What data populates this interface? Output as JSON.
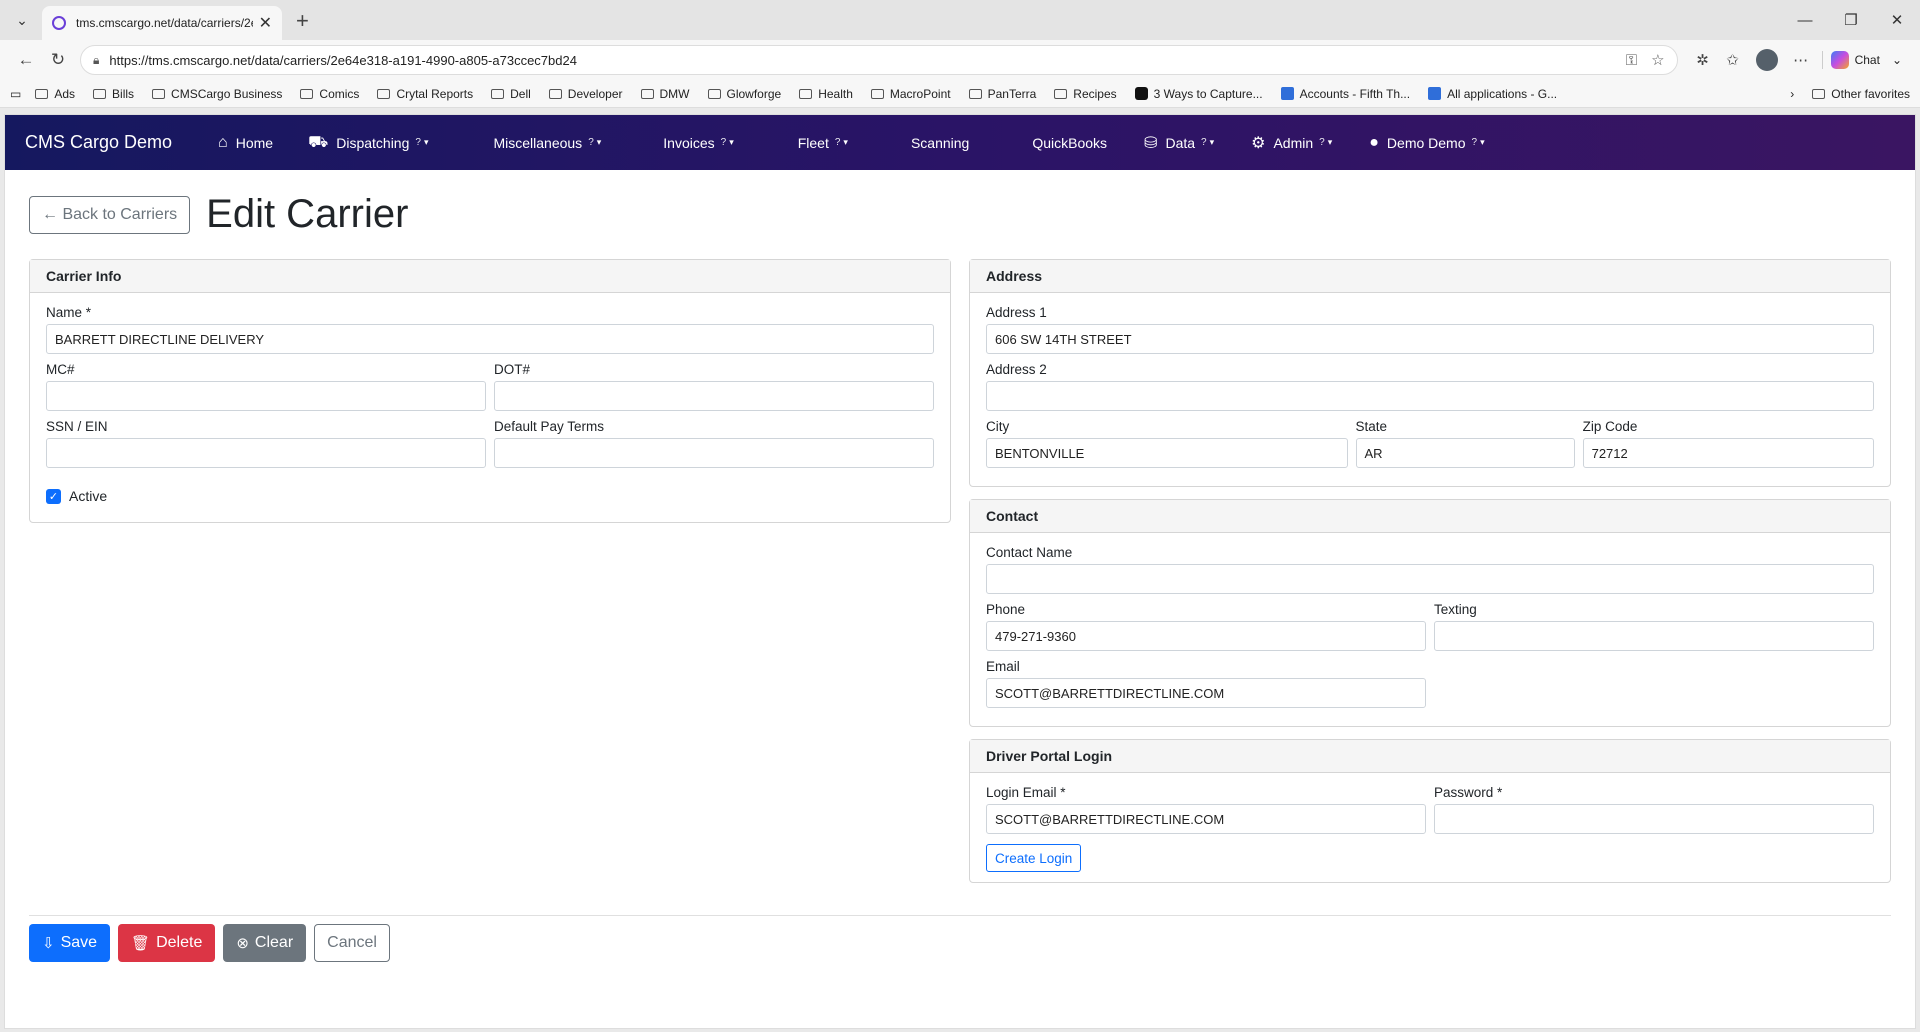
{
  "browser": {
    "tab_title": "tms.cmscargo.net/data/carriers/2e",
    "url": "https://tms.cmscargo.net/data/carriers/2e64e318-a191-4990-a805-a73ccec7bd24",
    "chat_label": "Chat",
    "bookmarks": [
      "Ads",
      "Bills",
      "CMSCargo Business",
      "Comics",
      "Crytal Reports",
      "Dell",
      "Developer",
      "DMW",
      "Glowforge",
      "Health",
      "MacroPoint",
      "PanTerra",
      "Recipes",
      "3 Ways to Capture...",
      "Accounts - Fifth Th...",
      "All applications - G..."
    ],
    "other_favorites": "Other favorites"
  },
  "nav": {
    "brand": "CMS Cargo Demo",
    "items": {
      "home": "Home",
      "dispatching": "Dispatching",
      "miscellaneous": "Miscellaneous",
      "invoices": "Invoices",
      "fleet": "Fleet",
      "scanning": "Scanning",
      "quickbooks": "QuickBooks",
      "data": "Data",
      "admin": "Admin",
      "user": "Demo Demo"
    },
    "help_mark": "?"
  },
  "page": {
    "back_label": "← Back to Carriers",
    "title": "Edit Carrier"
  },
  "carrier_info": {
    "header": "Carrier Info",
    "name_label": "Name *",
    "name_value": "BARRETT DIRECTLINE DELIVERY",
    "mc_label": "MC#",
    "mc_value": "",
    "dot_label": "DOT#",
    "dot_value": "",
    "ssn_label": "SSN / EIN",
    "ssn_value": "",
    "pay_terms_label": "Default Pay Terms",
    "pay_terms_value": "",
    "active_label": "Active",
    "active_checked": true
  },
  "address": {
    "header": "Address",
    "address1_label": "Address 1",
    "address1_value": "606 SW 14TH STREET",
    "address2_label": "Address 2",
    "address2_value": "",
    "city_label": "City",
    "city_value": "BENTONVILLE",
    "state_label": "State",
    "state_value": "AR",
    "zip_label": "Zip Code",
    "zip_value": "72712"
  },
  "contact": {
    "header": "Contact",
    "name_label": "Contact Name",
    "name_value": "",
    "phone_label": "Phone",
    "phone_value": "479-271-9360",
    "texting_label": "Texting",
    "texting_value": "",
    "email_label": "Email",
    "email_value": "SCOTT@BARRETTDIRECTLINE.COM"
  },
  "driver_portal": {
    "header": "Driver Portal Login",
    "login_email_label": "Login Email *",
    "login_email_value": "SCOTT@BARRETTDIRECTLINE.COM",
    "password_label": "Password *",
    "password_value": "",
    "create_login_label": "Create Login"
  },
  "actions": {
    "save": "Save",
    "delete": "Delete",
    "clear": "Clear",
    "cancel": "Cancel"
  },
  "colors": {
    "primary": "#0d6efd",
    "danger": "#dc3545",
    "secondary": "#6c757d",
    "nav_start": "#15185f",
    "nav_end": "#3a1562"
  }
}
